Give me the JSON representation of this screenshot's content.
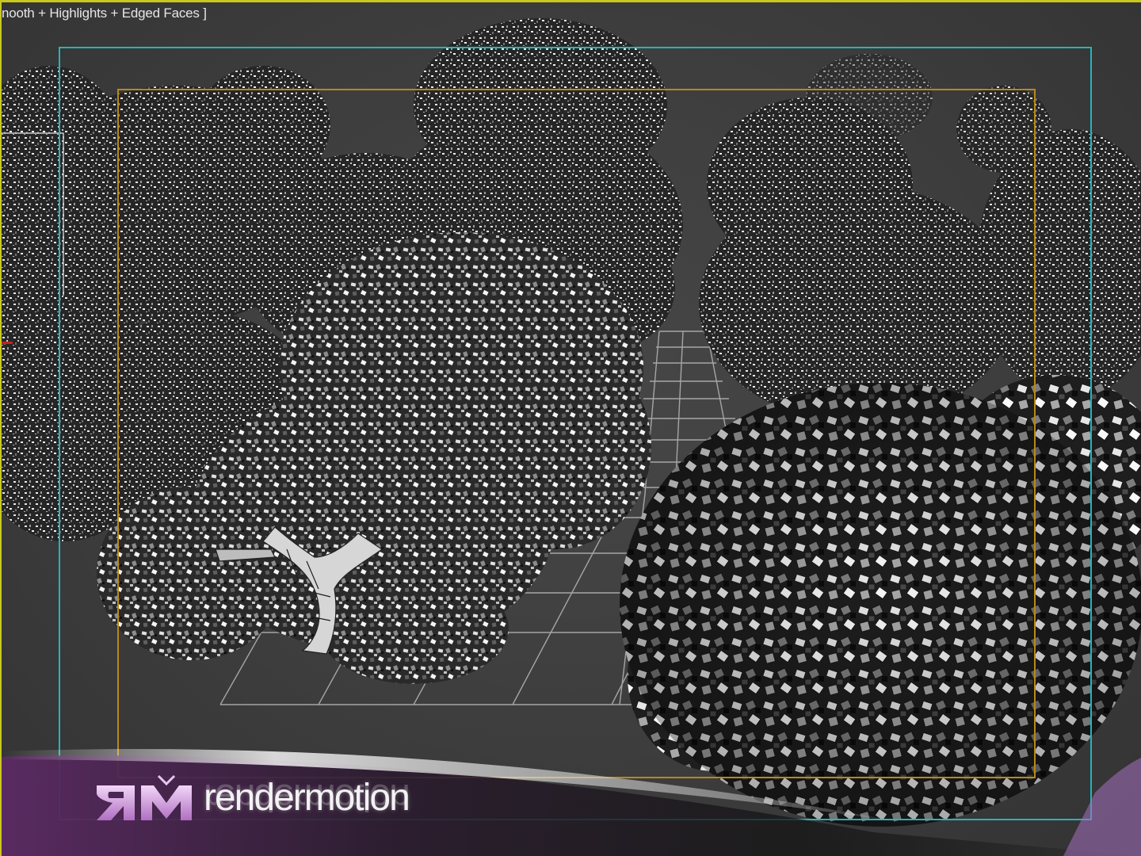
{
  "viewport": {
    "label": "nooth + Highlights + Edged Faces ]",
    "background": "#3d3d3d",
    "active_border_color": "#c8c81e",
    "safe_frame_colors": {
      "live_area": "#27b3b8",
      "action_safe": "#b8881a"
    }
  },
  "scene": {
    "objects": [
      "tree-canopy-left",
      "tree-canopy-center",
      "tree-canopy-right",
      "bush-foreground",
      "tree-trunk",
      "ground-grid"
    ],
    "render_mode": "Edged Faces"
  },
  "watermark": {
    "logo_mark": "ЯM",
    "brand": "rendermotion",
    "accent_color": "#b06fc2"
  }
}
